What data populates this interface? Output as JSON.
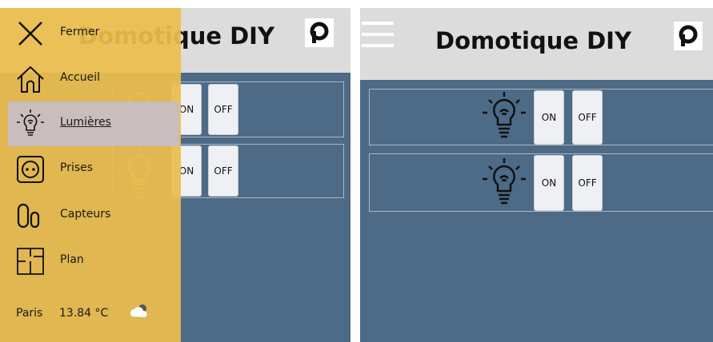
{
  "app": {
    "title": "Domotique DIY"
  },
  "drawer": {
    "items": [
      {
        "label": "Fermer",
        "icon": "close-icon"
      },
      {
        "label": "Accueil",
        "icon": "home-icon"
      },
      {
        "label": "Lumières",
        "icon": "bulb-icon",
        "active": true
      },
      {
        "label": "Prises",
        "icon": "socket-icon"
      },
      {
        "label": "Capteurs",
        "icon": "sensor-icon"
      },
      {
        "label": "Plan",
        "icon": "floorplan-icon"
      }
    ],
    "weather": {
      "city": "Paris",
      "temperature": "13.84 °C",
      "icon": "cloud-icon"
    }
  },
  "lights": [
    {
      "on_label": "ON",
      "off_label": "OFF"
    },
    {
      "on_label": "ON",
      "off_label": "OFF"
    }
  ],
  "colors": {
    "background": "#4d6a86",
    "appbar": "#dcdcdc",
    "drawer": "#ecbd4c",
    "active_item": "#c9bdbd"
  }
}
